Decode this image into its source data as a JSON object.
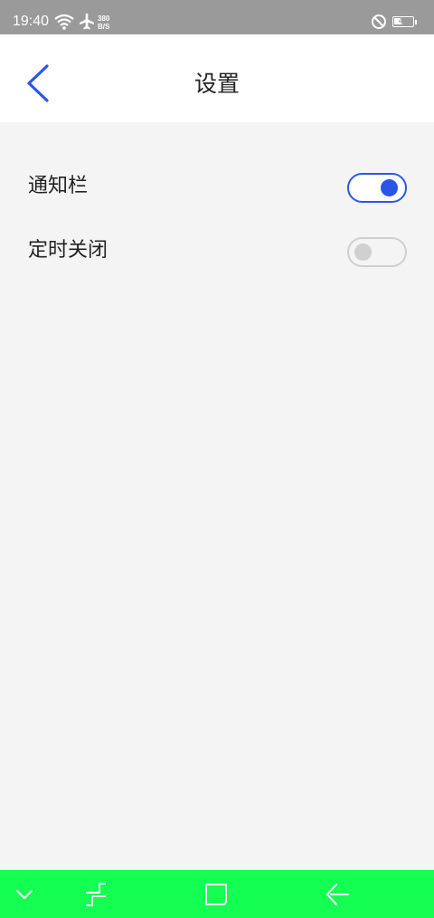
{
  "status_bar": {
    "time": "19:40",
    "net_speed_value": "380",
    "net_speed_unit": "B/S",
    "battery_level": "44",
    "icons": [
      "wifi-icon",
      "airplane-icon",
      "do-not-disturb-icon",
      "battery-icon"
    ]
  },
  "header": {
    "title": "设置",
    "back_icon": "chevron-left-icon"
  },
  "settings": [
    {
      "label": "通知栏",
      "enabled": true
    },
    {
      "label": "定时关闭",
      "enabled": false
    }
  ],
  "nav_bar": {
    "background": "#15ff52",
    "icons": [
      "chevron-down-icon",
      "recents-icon",
      "home-icon",
      "back-arrow-icon"
    ]
  },
  "colors": {
    "accent": "#2a56e8",
    "status_bar": "#9a9a9a",
    "header_bg": "#ffffff",
    "page_bg": "#f4f4f4",
    "toggle_off": "#cfcfcf"
  }
}
